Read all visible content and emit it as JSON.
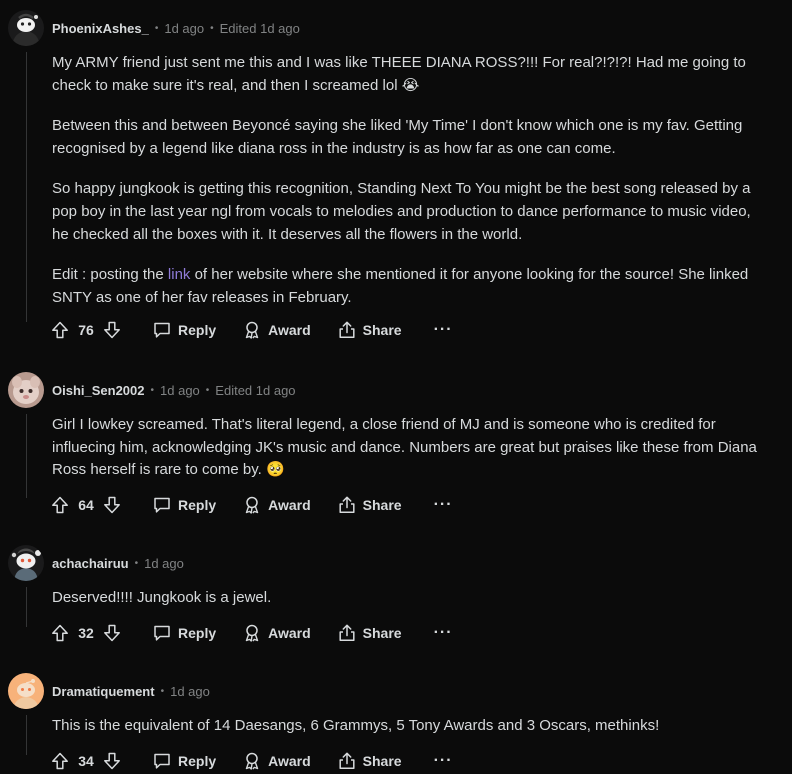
{
  "actions": {
    "reply": "Reply",
    "award": "Award",
    "share": "Share",
    "more": "···"
  },
  "comments": [
    {
      "author": "PhoenixAshes_",
      "time": "1d ago",
      "edited": "Edited 1d ago",
      "score": "76",
      "p1": "My ARMY friend just sent me this and I was like THEEE DIANA ROSS?!!! For real?!?!?! Had me going to check to make sure it's real, and then I screamed lol 😭",
      "p2": "Between this and between Beyoncé saying she liked 'My Time' I don't know which one is my fav. Getting recognised by a legend like diana ross in the industry is as how far as one can come.",
      "p3": "So happy jungkook is getting this recognition, Standing Next To You might be the best song released by a pop boy in the last year ngl from vocals to melodies and production to dance performance to music video, he checked all the boxes with it. It deserves all the flowers in the world.",
      "p4_before": "Edit : posting the ",
      "p4_link": "link",
      "p4_after": " of her website where she mentioned it for anyone looking for the source! She linked SNTY as one of her fav releases in February."
    },
    {
      "author": "Oishi_Sen2002",
      "time": "1d ago",
      "edited": "Edited 1d ago",
      "score": "64",
      "p1": "Girl I lowkey screamed. That's literal legend, a close friend of MJ and is someone who is credited for influecing him, acknowledging JK's music and dance. Numbers are great but praises like these from Diana Ross herself is rare to come by. 🥺"
    },
    {
      "author": "achachairuu",
      "time": "1d ago",
      "score": "32",
      "p1": "Deserved!!!! Jungkook is a jewel."
    },
    {
      "author": "Dramatiquement",
      "time": "1d ago",
      "score": "34",
      "p1": "This is the equivalent of 14 Daesangs, 6 Grammys, 5 Tony Awards and 3 Oscars, methinks!"
    }
  ]
}
